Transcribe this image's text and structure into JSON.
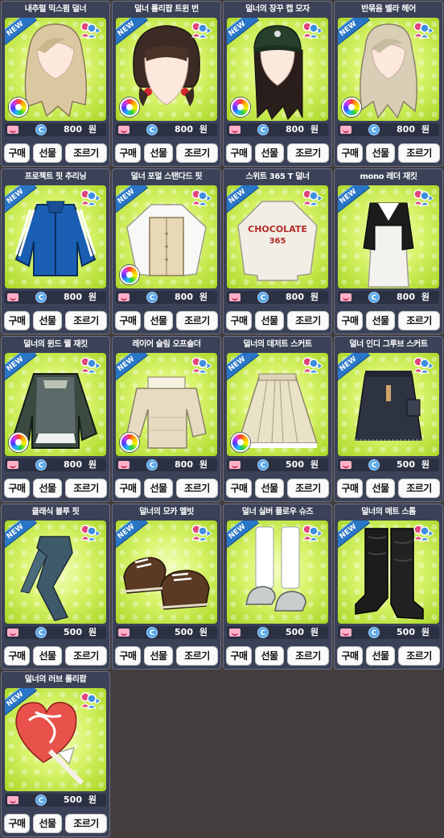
{
  "labels": {
    "buy": "구매",
    "gift": "선물",
    "ask": "조르기",
    "new_badge": "NEW",
    "currency": "원"
  },
  "items": [
    {
      "name": "내추럴 믹스펌 덜너",
      "price": "800",
      "art": "hair-wavy-blonde",
      "dye": true
    },
    {
      "name": "덜너 롤리팝 트윈 번",
      "price": "800",
      "art": "hair-bob-brown",
      "dye": true
    },
    {
      "name": "덜너의 장꾸 캡 모자",
      "price": "800",
      "art": "hair-cap-black",
      "dye": true
    },
    {
      "name": "반묶음 벨라 헤어",
      "price": "800",
      "art": "hair-half-blonde",
      "dye": true
    },
    {
      "name": "프로젝트 핏 추리닝",
      "price": "800",
      "art": "track-jacket-blue",
      "dye": false
    },
    {
      "name": "덜너 포멀 스탠다드 핏",
      "price": "800",
      "art": "blouse-vest",
      "dye": true
    },
    {
      "name": "스위트 365 T 덜너",
      "price": "800",
      "art": "sweatshirt-chocolate",
      "dye": false
    },
    {
      "name": "mono 레더 재킷",
      "price": "800",
      "art": "leather-jacket-long",
      "dye": false
    },
    {
      "name": "덜너의 윈드 웰 재킷",
      "price": "800",
      "art": "wind-jacket",
      "dye": true
    },
    {
      "name": "레이어 슬림 오프숄더",
      "price": "800",
      "art": "offshoulder-knit",
      "dye": true
    },
    {
      "name": "덜너의 데저트 스커트",
      "price": "500",
      "art": "pleated-skirt",
      "dye": true
    },
    {
      "name": "덜너 인디 그루브 스커트",
      "price": "500",
      "art": "denim-skirt",
      "dye": false
    },
    {
      "name": "클래식 블루 핏",
      "price": "500",
      "art": "blue-jeans",
      "dye": false
    },
    {
      "name": "덜너의 모카 멜빗",
      "price": "500",
      "art": "brown-shoes",
      "dye": false
    },
    {
      "name": "덜너 실버 플로우 슈즈",
      "price": "500",
      "art": "silver-shoes",
      "dye": false
    },
    {
      "name": "덜너의 매트 스톰",
      "price": "500",
      "art": "black-boots",
      "dye": false
    },
    {
      "name": "덜너의 러브 롤리팝",
      "price": "500",
      "art": "heart-lollipop",
      "dye": false
    }
  ]
}
